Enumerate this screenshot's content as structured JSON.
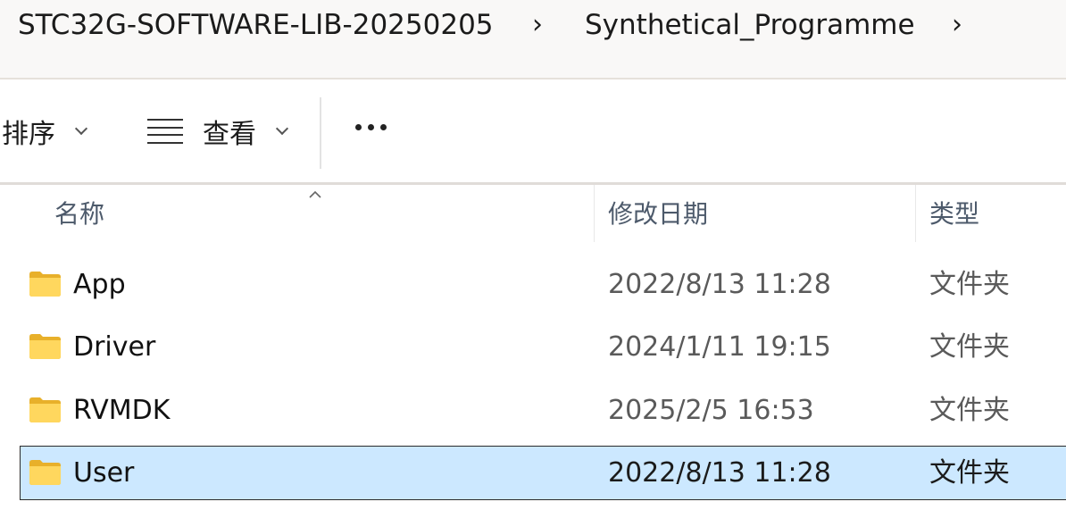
{
  "breadcrumb": {
    "segments": [
      "STC32G-SOFTWARE-LIB-20250205",
      "Synthetical_Programme"
    ],
    "separator_icon": "chevron-right-icon"
  },
  "toolbar": {
    "sort_label": "排序",
    "view_label": "查看",
    "view_icon": "list-view-icon",
    "more_icon": "ellipsis-icon"
  },
  "columns": {
    "name": "名称",
    "date_modified": "修改日期",
    "type": "类型",
    "sorted_by": "name",
    "sort_direction": "ascending"
  },
  "files": [
    {
      "name": "App",
      "date": "2022/8/13 11:28",
      "type": "文件夹",
      "icon": "folder-icon",
      "selected": false
    },
    {
      "name": "Driver",
      "date": "2024/1/11 19:15",
      "type": "文件夹",
      "icon": "folder-icon",
      "selected": false
    },
    {
      "name": "RVMDK",
      "date": "2025/2/5 16:53",
      "type": "文件夹",
      "icon": "folder-icon",
      "selected": false
    },
    {
      "name": "User",
      "date": "2022/8/13 11:28",
      "type": "文件夹",
      "icon": "folder-icon",
      "selected": true
    }
  ],
  "colors": {
    "selection_bg": "#cce8ff",
    "folder_yellow": "#ffd75e",
    "header_text": "#4d5a6b"
  }
}
